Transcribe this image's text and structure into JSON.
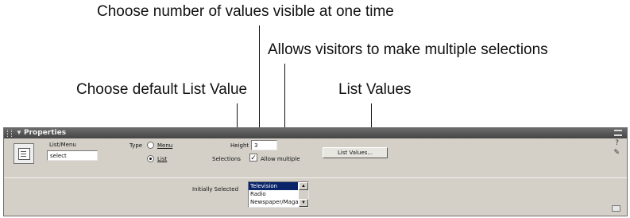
{
  "callouts": {
    "visible_count": "Choose number of values visible at one time",
    "allow_multiple": "Allows visitors to make multiple selections",
    "default_value": "Choose default List Value",
    "list_values": "List Values"
  },
  "panel": {
    "title": "Properties",
    "element_type": "List/Menu",
    "name_value": "select",
    "type_label": "Type",
    "type_options": [
      {
        "label": "Menu",
        "selected": false
      },
      {
        "label": "List",
        "selected": true
      }
    ],
    "height_label": "Height",
    "height_value": "3",
    "selections_label": "Selections",
    "allow_multiple_label": "Allow multiple",
    "allow_multiple_checked": true,
    "list_values_button": "List Values...",
    "initially_selected_label": "Initially Selected",
    "list_items": [
      {
        "label": "Television",
        "selected": true
      },
      {
        "label": "Radio",
        "selected": false
      },
      {
        "label": "Newspaper/Magazine",
        "selected": false
      }
    ],
    "icons": {
      "help": "help-icon",
      "edit": "edit-icon",
      "options": "panel-options-icon",
      "expander": "expander-icon"
    }
  }
}
